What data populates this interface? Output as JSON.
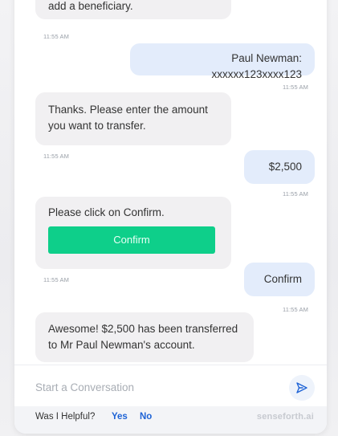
{
  "messages": {
    "m1": {
      "text": "add a beneficiary.",
      "time": "11:55 AM"
    },
    "m2": {
      "text": "Paul Newman: xxxxxx123xxxx123",
      "time": "11:55 AM"
    },
    "m3": {
      "text": "Thanks. Please enter the amount you want to transfer.",
      "time": "11:55 AM"
    },
    "m4": {
      "text": "$2,500",
      "time": "11:55 AM"
    },
    "m5": {
      "text": "Please click on Confirm.",
      "button_label": "Confirm",
      "time": "11:55 AM"
    },
    "m6": {
      "text": "Confirm",
      "time": "11:55 AM"
    },
    "m7": {
      "text": "Awesome! $2,500 has been transferred to Mr Paul Newman's account."
    }
  },
  "composer": {
    "placeholder": "Start a Conversation",
    "send_icon": "send-icon"
  },
  "footer": {
    "question": "Was I Helpful?",
    "yes_label": "Yes",
    "no_label": "No",
    "brand": "senseforth.ai"
  },
  "colors": {
    "accent_green": "#0ecf8a",
    "user_bubble": "#e3ecfb",
    "bot_bubble": "#f1f0f2",
    "link_blue": "#1e63d6"
  }
}
